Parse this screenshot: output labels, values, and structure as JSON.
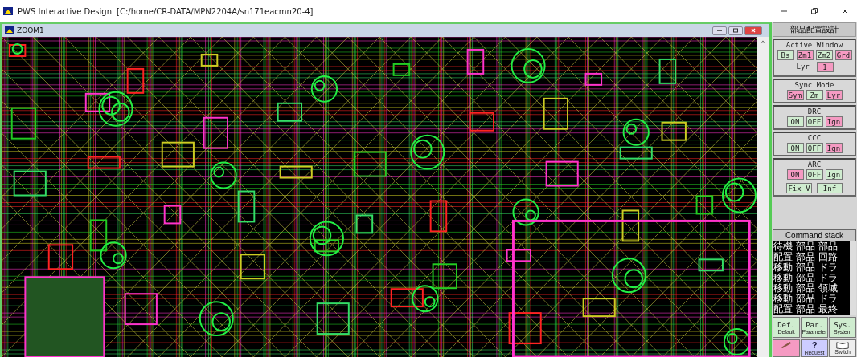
{
  "window": {
    "title": "PWS Interactive Design",
    "path": "[C:/home/CR-DATA/MPN2204A/sn171eacmn20-4]"
  },
  "zoom_window": {
    "title": "ZOOM1"
  },
  "panel": {
    "title": "部品配置設計",
    "groups": [
      {
        "title": "Active Window",
        "buttons": [
          {
            "label": "Bs",
            "kind": "toggle",
            "selected": false
          },
          {
            "label": "Zm1",
            "kind": "toggle",
            "selected": true
          },
          {
            "label": "Zm2",
            "kind": "toggle",
            "selected": false
          },
          {
            "label": "Grd",
            "kind": "toggle",
            "selected": true
          },
          {
            "label": "Lyr",
            "kind": "label"
          },
          {
            "label": "1",
            "kind": "value",
            "selected": true
          }
        ]
      },
      {
        "title": "Sync Mode",
        "buttons": [
          {
            "label": "Sym",
            "kind": "toggle",
            "selected": true
          },
          {
            "label": "Zm",
            "kind": "toggle",
            "selected": false
          },
          {
            "label": "Lyr",
            "kind": "toggle",
            "selected": true
          }
        ]
      },
      {
        "title": "DRC",
        "buttons": [
          {
            "label": "ON",
            "kind": "toggle",
            "selected": false
          },
          {
            "label": "OFF",
            "kind": "toggle",
            "selected": false
          },
          {
            "label": "Ign",
            "kind": "toggle",
            "selected": true
          }
        ]
      },
      {
        "title": "CCC",
        "buttons": [
          {
            "label": "ON",
            "kind": "toggle",
            "selected": false
          },
          {
            "label": "OFF",
            "kind": "toggle",
            "selected": false
          },
          {
            "label": "Ign",
            "kind": "toggle",
            "selected": true
          }
        ]
      },
      {
        "title": "ARC",
        "buttons": [
          {
            "label": "ON",
            "kind": "toggle",
            "selected": true
          },
          {
            "label": "OFF",
            "kind": "toggle",
            "selected": false
          },
          {
            "label": "Ign",
            "kind": "toggle",
            "selected": false
          }
        ],
        "extra": [
          {
            "label": "Fix-V"
          },
          {
            "label": "Inf"
          }
        ]
      }
    ],
    "command_stack": {
      "title": "Command stack",
      "lines": [
        "待機 部品 部品",
        "配置 部品 回路",
        "移動 部品 ドラ",
        "移動 部品 ドラ",
        "移動 部品 領域",
        "移動 部品 ドラ",
        "配置 部品 最終"
      ]
    },
    "modes": [
      {
        "label": "Def.",
        "caption": "Default"
      },
      {
        "label": "Par.",
        "caption": "Parameter"
      },
      {
        "label": "Sys.",
        "caption": "System"
      }
    ],
    "tools": [
      {
        "kind": "pen"
      },
      {
        "kind": "help",
        "label": "?",
        "caption": "Request"
      },
      {
        "kind": "book",
        "caption": "Switch"
      }
    ]
  }
}
